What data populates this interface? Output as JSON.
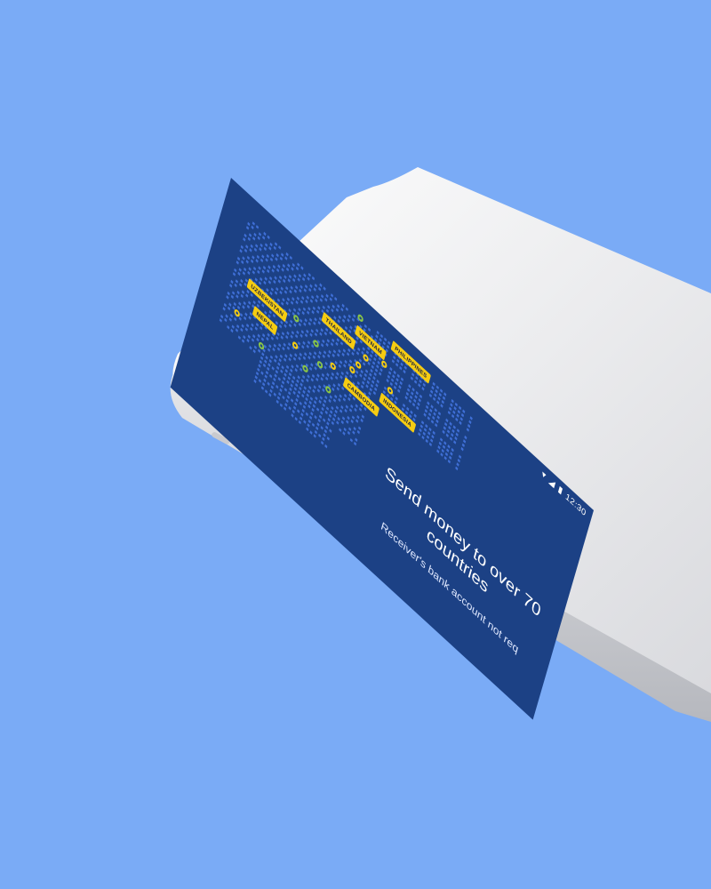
{
  "colors": {
    "background": "#7aabf6",
    "device": "#f1f1f3",
    "screen": "#1c4185",
    "map_dots": "#3f6fd6",
    "label": "#f5cc12",
    "pin_yellow": "#f5cc12",
    "pin_green": "#89c447"
  },
  "status_bar": {
    "time": "12:30"
  },
  "map": {
    "labels": [
      "UZBEKISTAN",
      "NEPAL",
      "THAILAND",
      "VIETNAM",
      "PHILIPPINES",
      "CAMBODIA",
      "INDONESIA"
    ]
  },
  "content": {
    "headline": "Send money to over 70 countries",
    "subtext": "Receiver's bank account not req"
  },
  "icons": [
    "signal-icon",
    "wifi-icon",
    "battery-icon",
    "map-pin-icon"
  ]
}
